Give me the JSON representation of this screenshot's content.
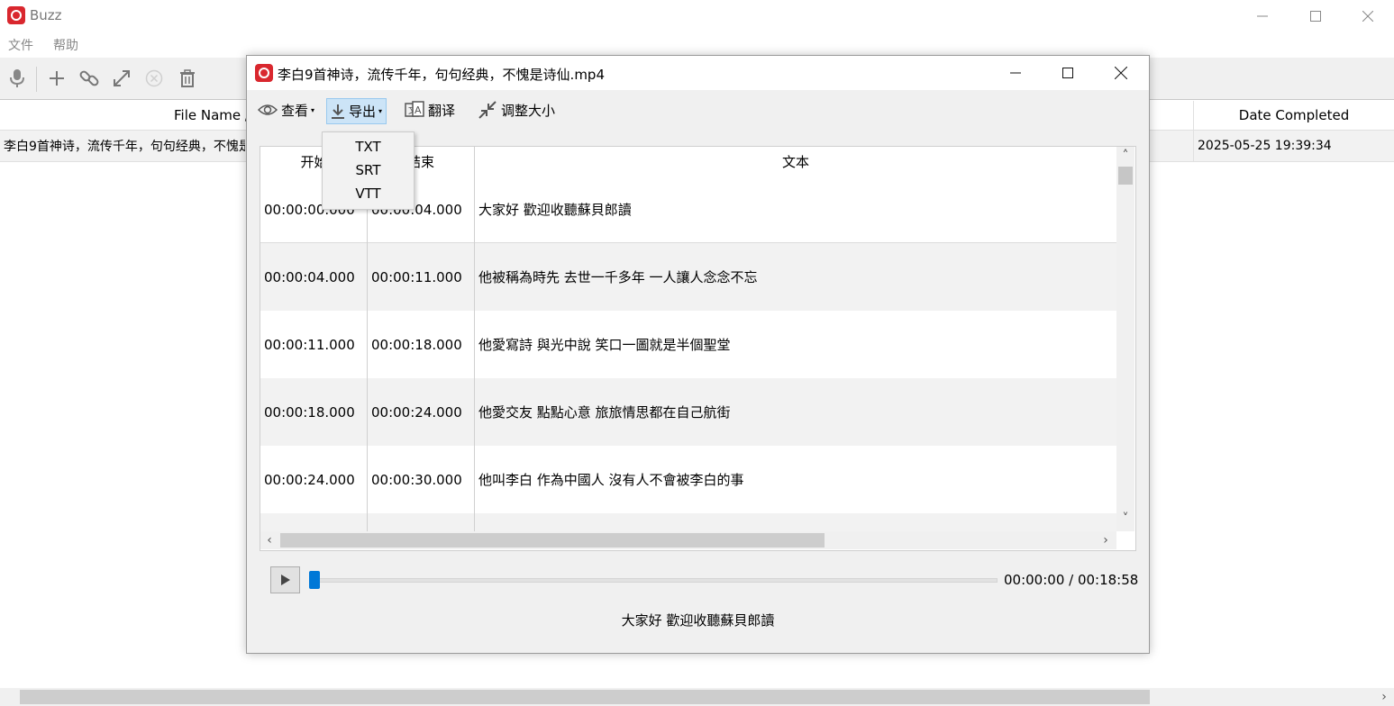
{
  "app": {
    "title": "Buzz"
  },
  "menubar": [
    "文件",
    "帮助"
  ],
  "main_table": {
    "columns": [
      "File Name /",
      "Date Completed"
    ],
    "rows": [
      {
        "file_name": "李白9首神诗，流传千年，句句经典，不愧是诗仙.mp4",
        "date_completed": "2025-05-25 19:39:34"
      }
    ]
  },
  "dialog": {
    "title": "李白9首神诗，流传千年，句句经典，不愧是诗仙.mp4",
    "toolbar": {
      "view": "查看",
      "export": "导出",
      "translate": "翻译",
      "resize": "调整大小"
    },
    "export_menu": [
      "TXT",
      "SRT",
      "VTT"
    ],
    "table": {
      "columns": [
        "开始",
        "结束",
        "文本"
      ],
      "rows": [
        {
          "start": "00:00:00.000",
          "end": "00:00:04.000",
          "text": "大家好 歡迎收聽蘇貝郎讀"
        },
        {
          "start": "00:00:04.000",
          "end": "00:00:11.000",
          "text": "他被稱為時先 去世一千多年 一人讓人念念不忘"
        },
        {
          "start": "00:00:11.000",
          "end": "00:00:18.000",
          "text": "他愛寫詩 與光中說 笑口一圖就是半個聖堂"
        },
        {
          "start": "00:00:18.000",
          "end": "00:00:24.000",
          "text": "他愛交友 點點心意 旅旅情思都在自己航街"
        },
        {
          "start": "00:00:24.000",
          "end": "00:00:30.000",
          "text": "他叫李白 作為中國人 沒有人不會被李白的事"
        }
      ]
    },
    "player": {
      "time": "00:00:00 / 00:18:58",
      "progress": 0.0
    },
    "current_subtitle": "大家好 歡迎收聽蘇貝郎讀"
  },
  "colors": {
    "brand": "#d9272e",
    "accent": "#0078d7"
  }
}
